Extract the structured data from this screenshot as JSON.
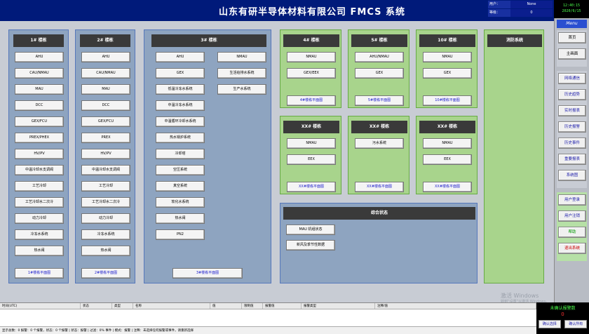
{
  "title": "山东有研半导体材料有限公司 FMCS 系统",
  "user": {
    "user_label": "用户：",
    "user_value": "None",
    "level_label": "等级：",
    "level_value": "0"
  },
  "clock": {
    "time": "12:40:15",
    "date": "2020/6/15"
  },
  "menu": "Menu",
  "nav_top": [
    "首页",
    "主画面"
  ],
  "nav_mid": [
    "网络通信",
    "历史趋势",
    "实时报表",
    "历史报警",
    "历史事件",
    "重要报表",
    "系统图"
  ],
  "nav_bottom": [
    "用户登录",
    "用户注销",
    "帮助",
    "退出系统"
  ],
  "b1": {
    "head": "1# 楼栋",
    "items": [
      "AHU",
      "CAU/NMAU",
      "MAU",
      "DCC",
      "GEX/FCU",
      "PREX/PHEX",
      "HV/PV",
      "中温冷却水支调阀",
      "工艺冷却",
      "工艺冷却水二次冷",
      "动力冷却",
      "冷冻水系统",
      "热水阀"
    ],
    "link": "1#楼栋平面图"
  },
  "b2": {
    "head": "2# 楼栋",
    "items": [
      "AHU",
      "CAU/NMAU",
      "MAU",
      "DCC",
      "GEX/FCU",
      "PREX",
      "HV/PV",
      "中温冷却水支调阀",
      "工艺冷却",
      "工艺冷却水二次冷",
      "动力冷却",
      "冷冻水系统",
      "热水阀"
    ],
    "link": "2#楼栋平面图"
  },
  "b3": {
    "head": "3# 楼栋",
    "col1": [
      "AHU",
      "GEX",
      "低温冷冻水系统",
      "中温冷冻水系统",
      "中温循环冷却水系统",
      "热水锅炉系统",
      "冷却塔",
      "空压系统",
      "真空系统",
      "软化水系统",
      "热水阀",
      "PN2"
    ],
    "col2": [
      "NMAU",
      "生活给排水系统",
      "生产水系统"
    ],
    "link": "3#楼栋平面图"
  },
  "b4": {
    "head": "4# 楼栋",
    "items": [
      "NMAU",
      "GEX/EEX"
    ],
    "link": "4#楼栋平面图"
  },
  "b5": {
    "head": "5# 楼栋",
    "items": [
      "AHU/NMAU",
      "GEX"
    ],
    "link": "5#楼栋平面图"
  },
  "b10": {
    "head": "10# 楼栋",
    "items": [
      "NMAU",
      "GEX"
    ],
    "link": "10#楼栋平面图"
  },
  "fire": {
    "head": "消防系统"
  },
  "bxx1": {
    "head": "XX# 楼栋",
    "items": [
      "NMAU",
      "EEX"
    ],
    "link": "XX#楼栋平面图"
  },
  "bxx2": {
    "head": "XX# 楼栋",
    "items": [
      "污水系统"
    ],
    "link": "XX#楼栋平面图"
  },
  "bxx3": {
    "head": "XX# 楼栋",
    "items": [
      "NMAU",
      "EEX"
    ],
    "link": "XX#楼栋平面图"
  },
  "combo": {
    "head": "综合状态",
    "items": [
      "MAU 机组状态",
      "新风及季节性数据"
    ]
  },
  "alarm_cols": [
    "时间(UTC)",
    "状态",
    "类型",
    "名称",
    "值",
    "限制值",
    "报警值",
    "报警类型",
    "注释/值"
  ],
  "status_line": "显示总数：0 报警：0 个报警，状态：0 个报警 | 状态：报警 | 过滤：0% 事件 | 模式：报警 | 注释：未选择任何报警或事件，请重新选择",
  "ack": {
    "title": "未确认报警数",
    "count": "0",
    "btn1": "确认选择",
    "btn2": "确认所有"
  },
  "watermark": {
    "line1": "激活 Windows",
    "line2": "转到“设置”以激活 Windows。"
  }
}
